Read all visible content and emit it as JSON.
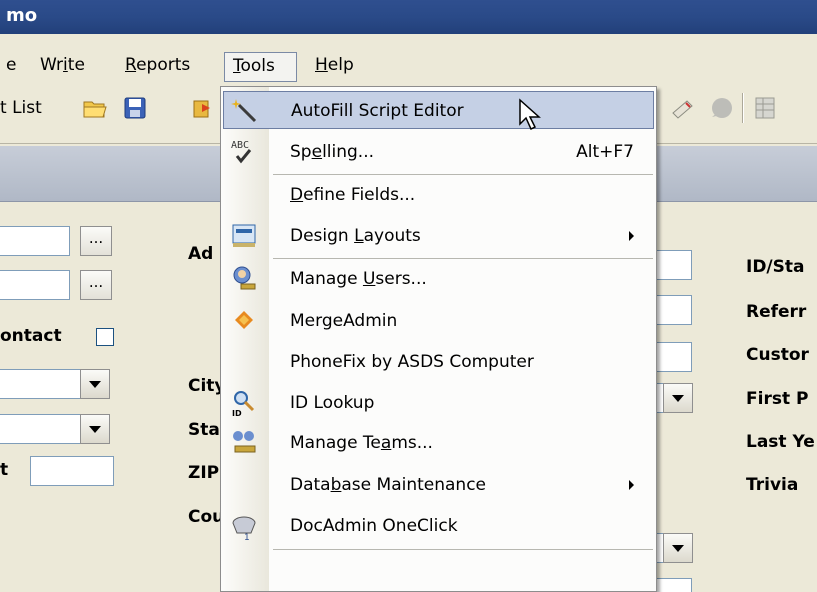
{
  "window": {
    "title": "mo"
  },
  "menubar": {
    "items": [
      {
        "id": "edit",
        "text": "e"
      },
      {
        "id": "write",
        "pre": "Wr",
        "u": "i",
        "post": "te"
      },
      {
        "id": "reports",
        "pre": "",
        "u": "R",
        "post": "eports"
      },
      {
        "id": "tools",
        "pre": "",
        "u": "T",
        "post": "ools"
      },
      {
        "id": "help",
        "pre": "",
        "u": "H",
        "post": "elp"
      }
    ]
  },
  "toolbar": {
    "text": "t List"
  },
  "tools_menu": {
    "items": [
      {
        "label": "AutoFill Script Editor",
        "icon": "magic-wand-icon"
      },
      {
        "pre": "Sp",
        "u": "e",
        "post": "lling...",
        "shortcut": "Alt+F7",
        "icon": "spell-check-icon",
        "icon_text": "ABC"
      },
      {
        "pre": "",
        "u": "D",
        "post": "efine Fields..."
      },
      {
        "pre": "Design ",
        "u": "L",
        "post": "ayouts",
        "icon": "design-layouts-icon"
      },
      {
        "pre": "Manage ",
        "u": "U",
        "post": "sers...",
        "icon": "manage-users-icon"
      },
      {
        "label": "MergeAdmin",
        "icon": "merge-admin-icon"
      },
      {
        "label": "PhoneFix by ASDS Computer"
      },
      {
        "label": "ID Lookup",
        "icon": "id-lookup-icon",
        "icon_text": "ID"
      },
      {
        "pre": "Manage Te",
        "u": "a",
        "post": "ms...",
        "icon": "manage-teams-icon"
      },
      {
        "pre": "Data",
        "u": "b",
        "post": "ase Maintenance"
      },
      {
        "label": "DocAdmin OneClick",
        "icon": "docadmin-icon",
        "icon_text": "1"
      }
    ]
  },
  "form": {
    "left": {
      "contact_label": "ontact",
      "last_label": "t"
    },
    "middle_labels": [
      "Ad",
      "City",
      "Sta",
      "ZIP",
      "Cou"
    ],
    "right_labels": [
      "ID/Sta",
      "Referr",
      "Custor",
      "First P",
      "Last Ye",
      "Trivia"
    ],
    "ellipsis": "..."
  }
}
